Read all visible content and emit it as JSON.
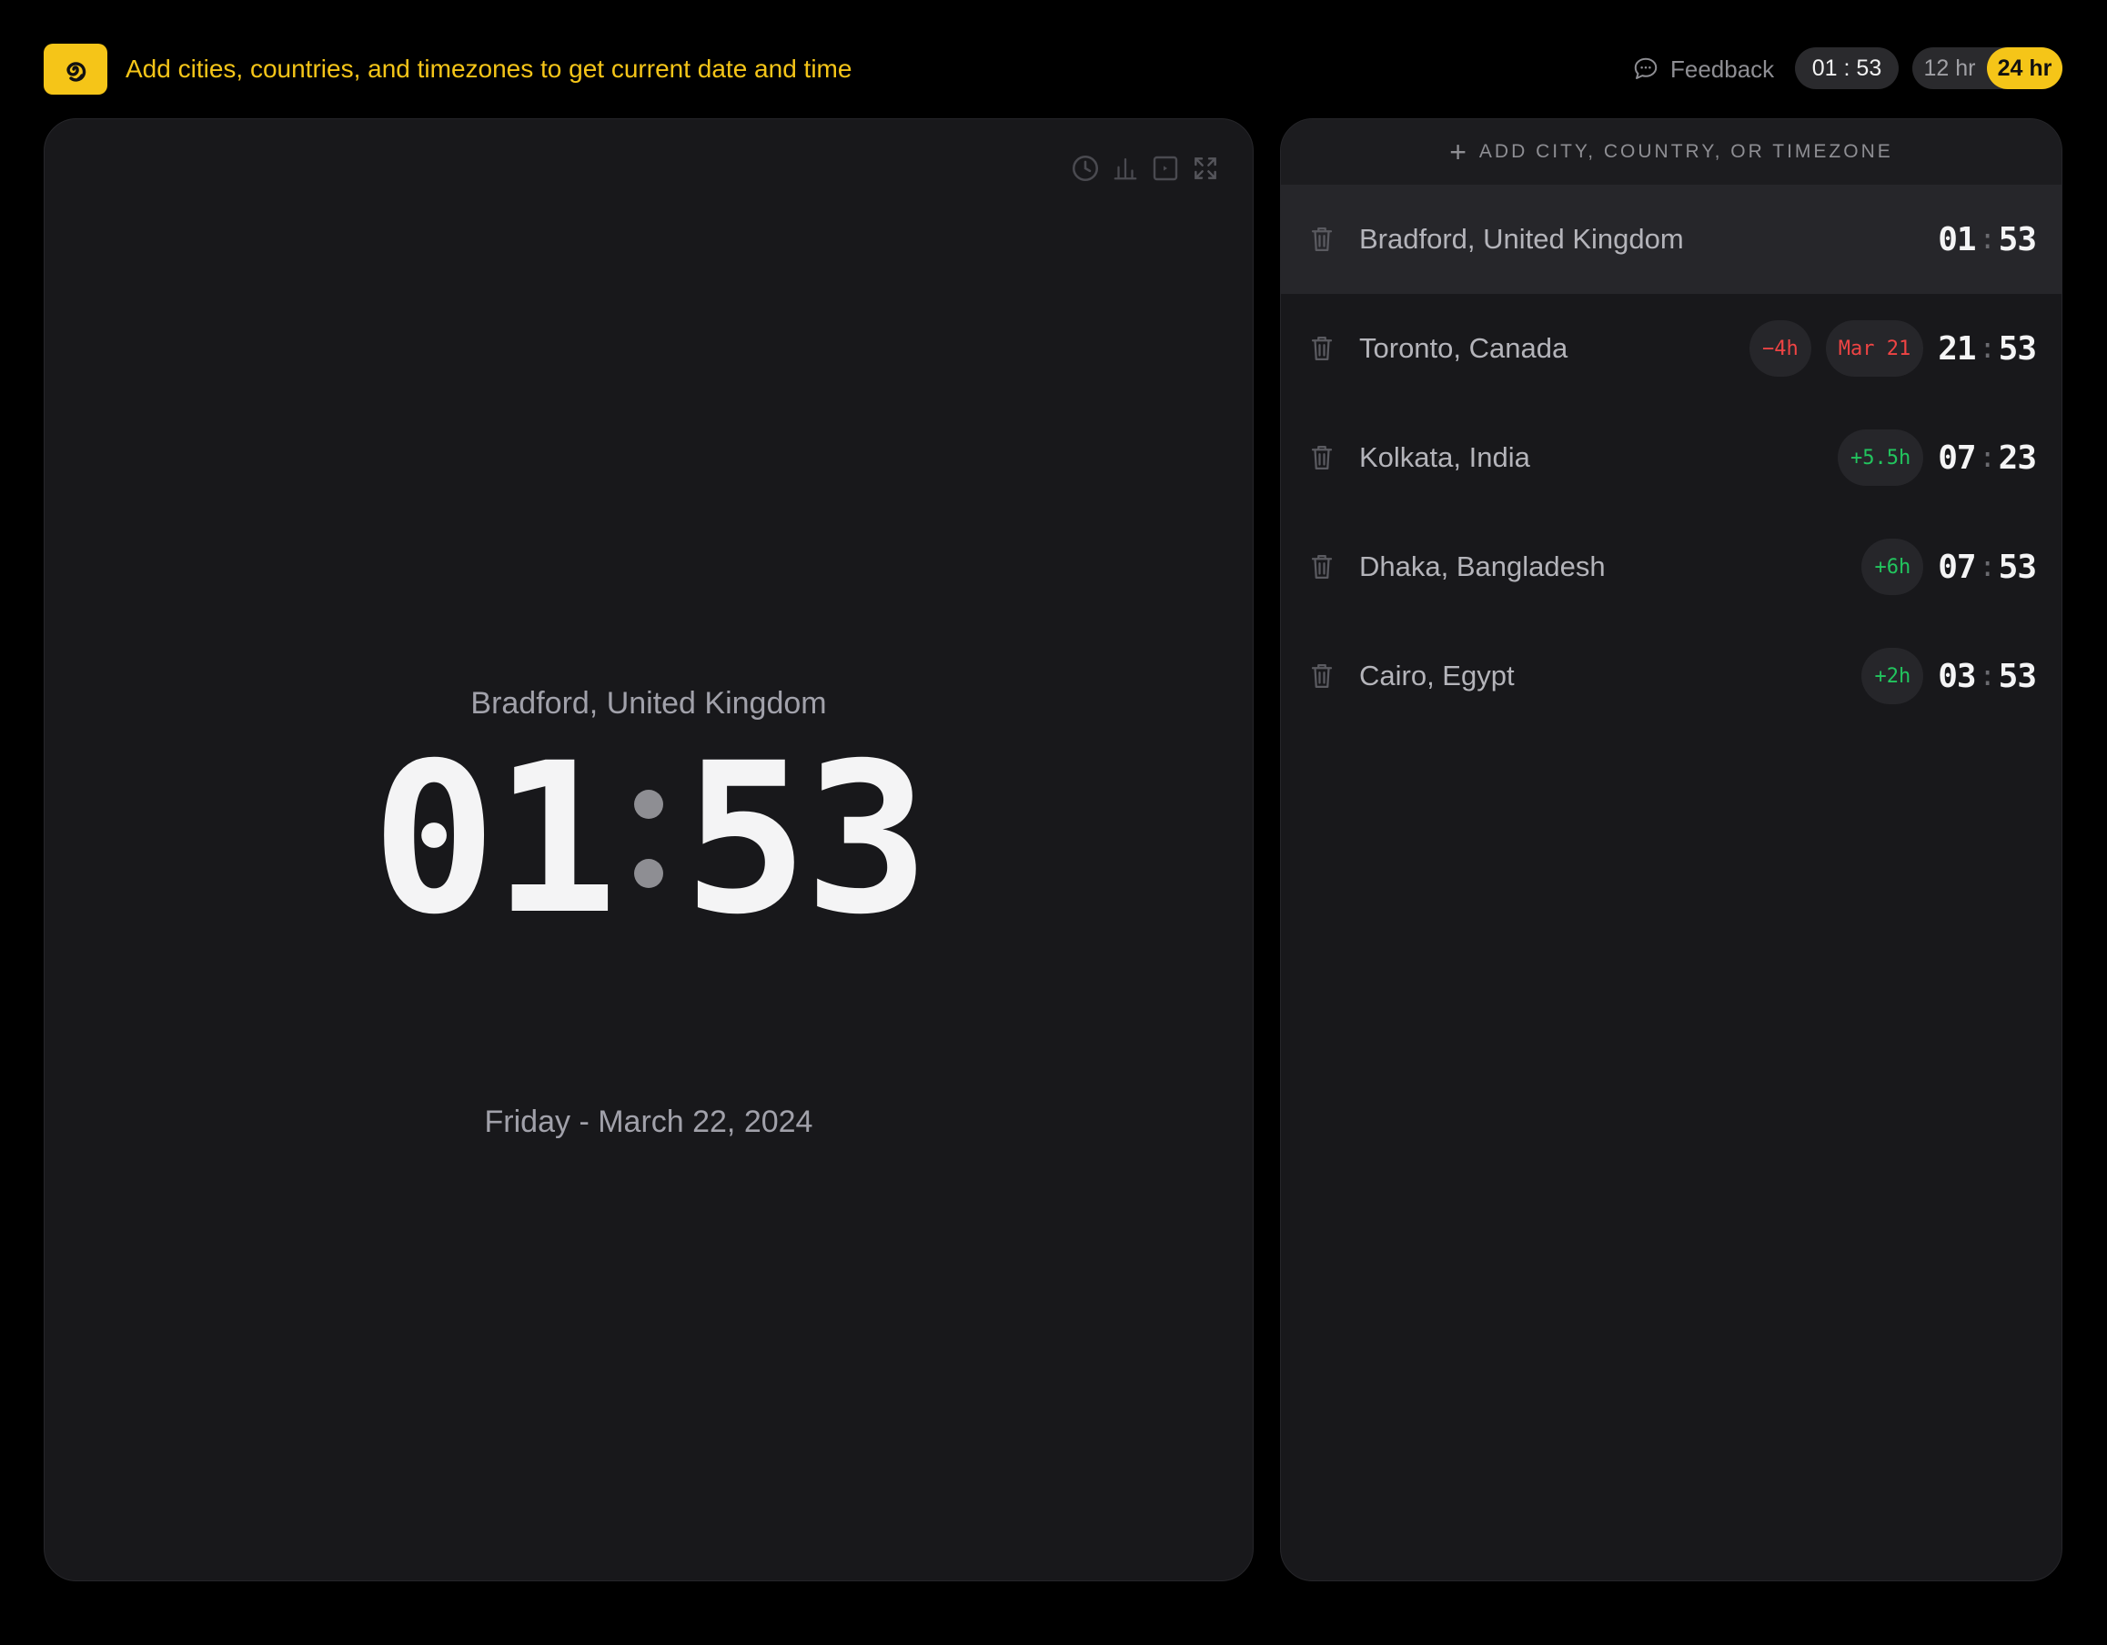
{
  "header": {
    "tagline": "Add cities, countries, and timezones to get current date and time",
    "feedback_label": "Feedback",
    "current_time": "01 : 53",
    "format_12": "12 hr",
    "format_24": "24 hr",
    "selected_format": "24 hr",
    "accent_color": "#f5c518"
  },
  "clock": {
    "city": "Bradford, United Kingdom",
    "hours": "01",
    "minutes": "53",
    "date": "Friday - March 22, 2024",
    "tools": [
      "clock-icon",
      "bar-chart-icon",
      "play-square-icon",
      "fullscreen-icon"
    ]
  },
  "list": {
    "add_label": "ADD CITY, COUNTRY, OR TIMEZONE",
    "cities": [
      {
        "name": "Bradford, United Kingdom",
        "offset": "",
        "date_badge": "",
        "hours": "01",
        "minutes": "53",
        "selected": true
      },
      {
        "name": "Toronto, Canada",
        "offset": "−4h",
        "date_badge": "Mar 21",
        "hours": "21",
        "minutes": "53",
        "selected": false
      },
      {
        "name": "Kolkata, India",
        "offset": "+5.5h",
        "date_badge": "",
        "hours": "07",
        "minutes": "23",
        "selected": false
      },
      {
        "name": "Dhaka, Bangladesh",
        "offset": "+6h",
        "date_badge": "",
        "hours": "07",
        "minutes": "53",
        "selected": false
      },
      {
        "name": "Cairo, Egypt",
        "offset": "+2h",
        "date_badge": "",
        "hours": "03",
        "minutes": "53",
        "selected": false
      }
    ],
    "negative_color": "#ef4444",
    "positive_color": "#22c55e"
  }
}
